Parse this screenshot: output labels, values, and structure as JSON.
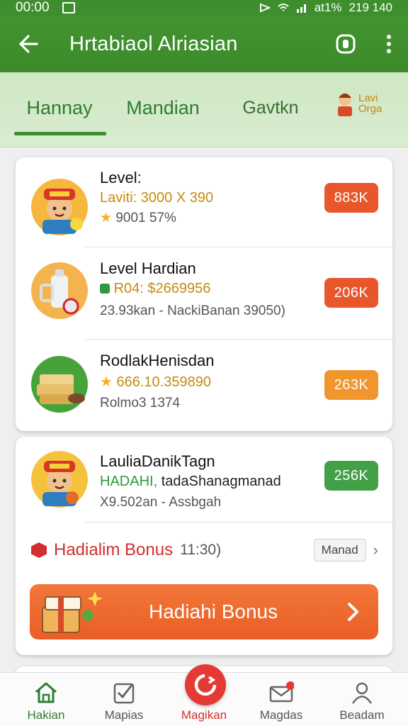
{
  "status_bar": {
    "time": "00:00",
    "right_text": "at1%",
    "clock2": "219 140"
  },
  "app_bar": {
    "title": "Hrtabiaol Alriasian"
  },
  "tabs": [
    {
      "label": "Hannay",
      "active": true
    },
    {
      "label": "Mandian",
      "active": false
    },
    {
      "label": "Gavtkn",
      "active": false
    }
  ],
  "tab_avatar": {
    "label_line1": "Lavi",
    "label_line2": "Orga"
  },
  "card1": {
    "rows": [
      {
        "title": "Level:",
        "sub": "Laviti: 3000 X 390",
        "meta": "9001 57%",
        "badge": "883K",
        "icon": "boy-with-cap-icon"
      },
      {
        "title": "Level Hardian",
        "sub": "R04: $2669956",
        "meta": "23.93kan - NackiBanan 39050)",
        "badge": "206K",
        "icon": "bottle-icon"
      },
      {
        "title": "RodlakHenisdan",
        "sub": "666.10.359890",
        "meta": "Rolmo3 1374",
        "badge": "263K",
        "icon": "gold-bars-icon"
      }
    ]
  },
  "card2": {
    "row": {
      "title": "LauliaDanikTagn",
      "sub_green": "HADAHI,",
      "sub_dark": "tadaShanagmanad",
      "meta": "X9.502an - Assbgah",
      "badge": "256K",
      "icon": "boy-with-cap-icon"
    },
    "bonus_line": {
      "label": "Hadialim Bonus",
      "count": "11:30)",
      "manage": "Manad"
    },
    "bonus_button": {
      "label": "Hadiahi Bonus"
    }
  },
  "bottom_nav": [
    {
      "label": "Hakian",
      "icon": "home-icon"
    },
    {
      "label": "Mapias",
      "icon": "checklist-icon"
    },
    {
      "label": "Magikan",
      "icon": "refresh-icon"
    },
    {
      "label": "Magdas",
      "icon": "mail-icon"
    },
    {
      "label": "Beadam",
      "icon": "user-icon"
    }
  ],
  "colors": {
    "primary_green": "#3e8e2e",
    "accent_orange": "#ea5e25",
    "badge_red": "#e8572b"
  }
}
